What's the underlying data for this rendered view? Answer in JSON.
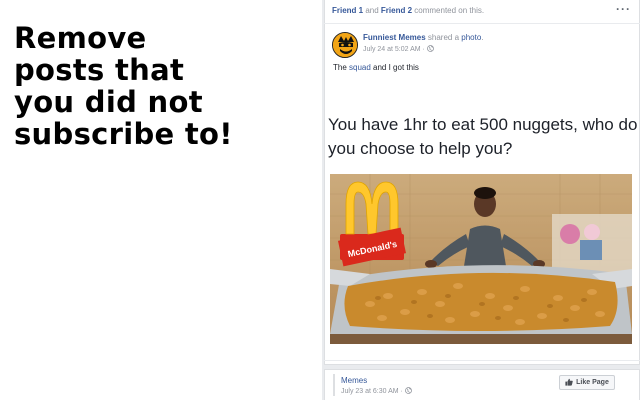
{
  "promo": {
    "lines": [
      "Remove",
      "posts that",
      "you did not",
      "subscribe to!"
    ]
  },
  "activity": {
    "friend1": "Friend 1",
    "and": " and ",
    "friend2": "Friend 2",
    "action": " commented on this."
  },
  "post": {
    "page_name": "Funniest Memes",
    "shared": " shared a ",
    "photo_link": "photo",
    "period": ".",
    "timestamp": "July 24 at 5:02 AM",
    "meta_separator": " · ",
    "caption_pre": "The ",
    "caption_link": "squad",
    "caption_post": " and I got this",
    "meme_text": "You have 1hr to eat 500 nuggets, who do you choose to help you?",
    "photo_sign": "McDonald's"
  },
  "next_post": {
    "page_name": "Memes",
    "timestamp": "July 23 at 6:30 AM",
    "meta_separator": " · ",
    "like_button": "Like Page"
  },
  "icons": [
    "more-options-icon",
    "globe-icon",
    "thumbs-up-icon",
    "golden-arches-icon"
  ],
  "colors": {
    "link": "#365899",
    "muted": "#90949c",
    "text": "#1d2129",
    "feed_bg": "#e9ebee",
    "border": "#dddfe2"
  }
}
